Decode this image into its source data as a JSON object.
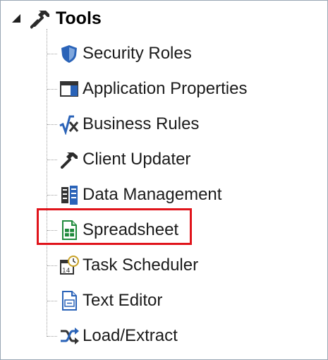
{
  "tree": {
    "root": {
      "label": "Tools",
      "icon": "hammer-icon",
      "expanded": true
    },
    "items": [
      {
        "label": "Security Roles",
        "icon": "shield-icon"
      },
      {
        "label": "Application Properties",
        "icon": "window-properties-icon"
      },
      {
        "label": "Business Rules",
        "icon": "formula-icon"
      },
      {
        "label": "Client Updater",
        "icon": "hammer-icon"
      },
      {
        "label": "Data Management",
        "icon": "database-icon"
      },
      {
        "label": "Spreadsheet",
        "icon": "spreadsheet-icon",
        "highlighted": true
      },
      {
        "label": "Task Scheduler",
        "icon": "calendar-clock-icon"
      },
      {
        "label": "Text Editor",
        "icon": "text-document-icon"
      },
      {
        "label": "Load/Extract",
        "icon": "shuffle-arrows-icon"
      }
    ]
  },
  "colors": {
    "highlight": "#e0141b",
    "icon_blue": "#2a63b8",
    "icon_green": "#1f8a3c"
  }
}
